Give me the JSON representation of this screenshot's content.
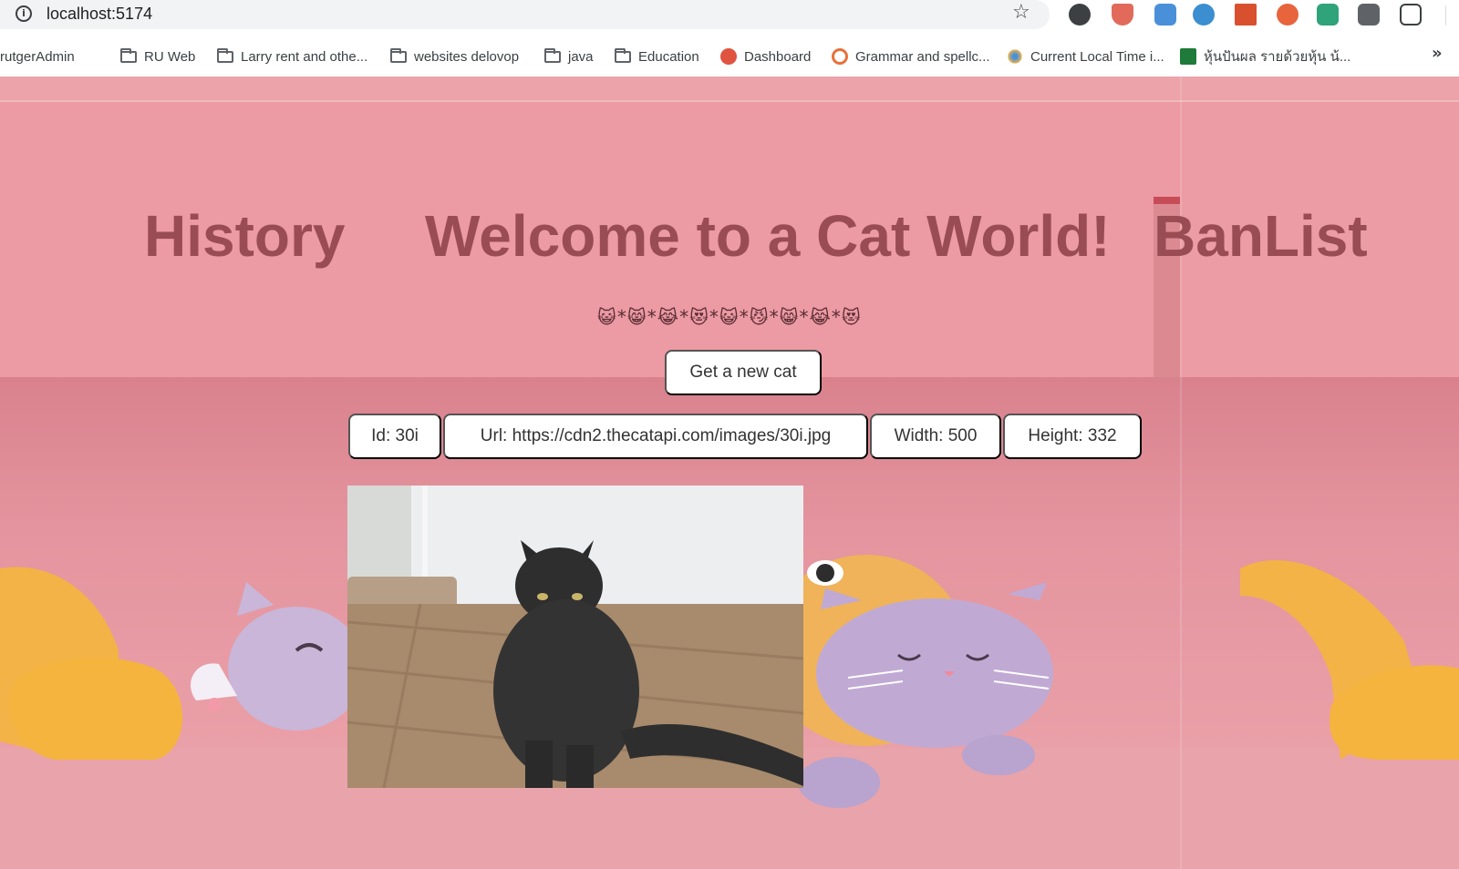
{
  "browser": {
    "url": "localhost:5174",
    "bookmarks": [
      {
        "label": "rutgerAdmin",
        "icon": "folder-icon"
      },
      {
        "label": "RU Web",
        "icon": "folder-icon"
      },
      {
        "label": "Larry rent and othe...",
        "icon": "folder-icon"
      },
      {
        "label": "websites delovop",
        "icon": "folder-icon"
      },
      {
        "label": "java",
        "icon": "folder-icon"
      },
      {
        "label": "Education",
        "icon": "folder-icon"
      },
      {
        "label": "Dashboard",
        "icon": "dashboard-favicon"
      },
      {
        "label": "Grammar and spellc...",
        "icon": "grammar-favicon"
      },
      {
        "label": "Current Local Time i...",
        "icon": "time-favicon"
      },
      {
        "label": "หุ้นปันผล รายด้วยหุ้น น้...",
        "icon": "stock-favicon"
      }
    ]
  },
  "page": {
    "nav_history": "History",
    "title": "Welcome to a Cat World!",
    "nav_banlist": "BanList",
    "emoji_line": "😺*😸*😹*😻*😺*😼*😸*😹*😻",
    "new_cat_button": "Get a new cat",
    "attributes": {
      "id": "Id: 30i",
      "url": "Url: https://cdn2.thecatapi.com/images/30i.jpg",
      "width": "Width: 500",
      "height": "Height: 332"
    },
    "image_alt": "cat"
  },
  "colors": {
    "page_bg": "#e9a0a8",
    "title_color": "#9a4c54",
    "button_bg": "#ffffff"
  }
}
